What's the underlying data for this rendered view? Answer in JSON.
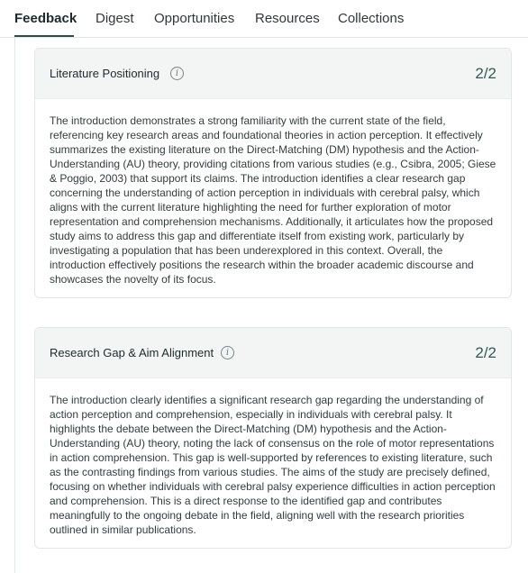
{
  "tabs": [
    {
      "label": "Feedback",
      "active": true
    },
    {
      "label": "Digest",
      "active": false
    },
    {
      "label": "Opportunities",
      "active": false
    },
    {
      "label": "Resources",
      "active": false
    },
    {
      "label": "Collections",
      "active": false
    }
  ],
  "cards": [
    {
      "title": "Literature Positioning",
      "info_icon": "info-icon",
      "score": "2/2",
      "body": "The introduction demonstrates a strong familiarity with the current state of the field, referencing key research areas and foundational theories in action perception. It effectively summarizes the existing literature on the Direct-Matching (DM) hypothesis and the Action-Understanding (AU) theory, providing citations from various studies (e.g., Csibra, 2005; Giese & Poggio, 2003) that support its claims. The introduction identifies a clear research gap concerning the understanding of action perception in individuals with cerebral palsy, which aligns with the current literature highlighting the need for further exploration of motor representation and comprehension mechanisms. Additionally, it articulates how the proposed study aims to address this gap and differentiate itself from existing work, particularly by investigating a population that has been underexplored in this context. Overall, the introduction effectively positions the research within the broader academic discourse and showcases the novelty of its focus."
    },
    {
      "title": "Research Gap & Aim Alignment",
      "info_icon": "info-icon",
      "score": "2/2",
      "body": "The introduction clearly identifies a significant research gap regarding the understanding of action perception and comprehension, especially in individuals with cerebral palsy. It highlights the debate between the Direct-Matching (DM) hypothesis and the Action-Understanding (AU) theory, noting the lack of consensus on the role of motor representations in action comprehension. This gap is well-supported by references to existing literature, such as the contrasting findings from various studies. The aims of the study are precisely defined, focusing on whether individuals with cerebral palsy experience difficulties in action perception and comprehension. This is a direct response to the identified gap and contributes meaningfully to the ongoing debate in the field, aligning well with the research priorities outlined in similar publications."
    }
  ],
  "colors": {
    "accent": "#2e4b47",
    "score": "#2f5a52",
    "card_header_bg": "#f2f5f4",
    "border": "#e3e6e6"
  }
}
